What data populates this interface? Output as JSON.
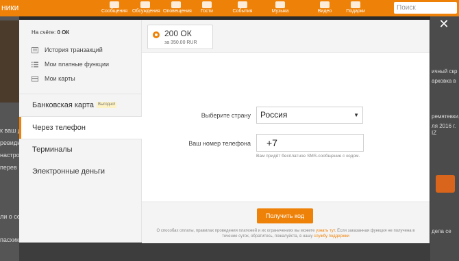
{
  "background": {
    "brand_partial": "ники",
    "nav": [
      "Сообщения",
      "Обсуждения",
      "Оповещения",
      "Гости",
      "События",
      "Музыка",
      "Видео",
      "Подарки"
    ],
    "search_placeholder": "Поиск",
    "left_snippets": [
      "к ваш др",
      "ревиди",
      "настро",
      "перев",
      "ли о се",
      "пасхик"
    ],
    "right_snippets": [
      "ичный скр",
      "арковка в",
      "ремятевки,",
      "ля 2016 г.",
      "IZ",
      "дела се"
    ]
  },
  "balance": {
    "label": "На счёте:",
    "value": "0 ОК"
  },
  "account_links": [
    {
      "label": "История транзакций",
      "icon": "history-icon"
    },
    {
      "label": "Мои платные функции",
      "icon": "list-icon"
    },
    {
      "label": "Мои карты",
      "icon": "card-icon"
    }
  ],
  "methods": [
    {
      "label": "Банковская карта",
      "badge": "Выгодно!"
    },
    {
      "label": "Через телефон"
    },
    {
      "label": "Терминалы"
    },
    {
      "label": "Электронные деньги"
    }
  ],
  "package": {
    "amount": "200 ОК",
    "price": "за 350.00 RUR"
  },
  "form": {
    "country_label": "Выберите страну",
    "country_value": "Россия",
    "phone_label": "Ваш номер телефона",
    "phone_value": "+7",
    "hint": "Вам придёт бесплатное SMS-сообщение с кодом."
  },
  "submit_label": "Получить код",
  "note": {
    "part1": "О способах оплаты, правилах проведения платежей и их ограничениях вы можете ",
    "link1": "узнать тут",
    "part2": ". Если заказанная функция не получена в течение суток, обратитесь, пожалуйста, в нашу ",
    "link2": "службу поддержки"
  },
  "colors": {
    "accent": "#ee8208"
  }
}
